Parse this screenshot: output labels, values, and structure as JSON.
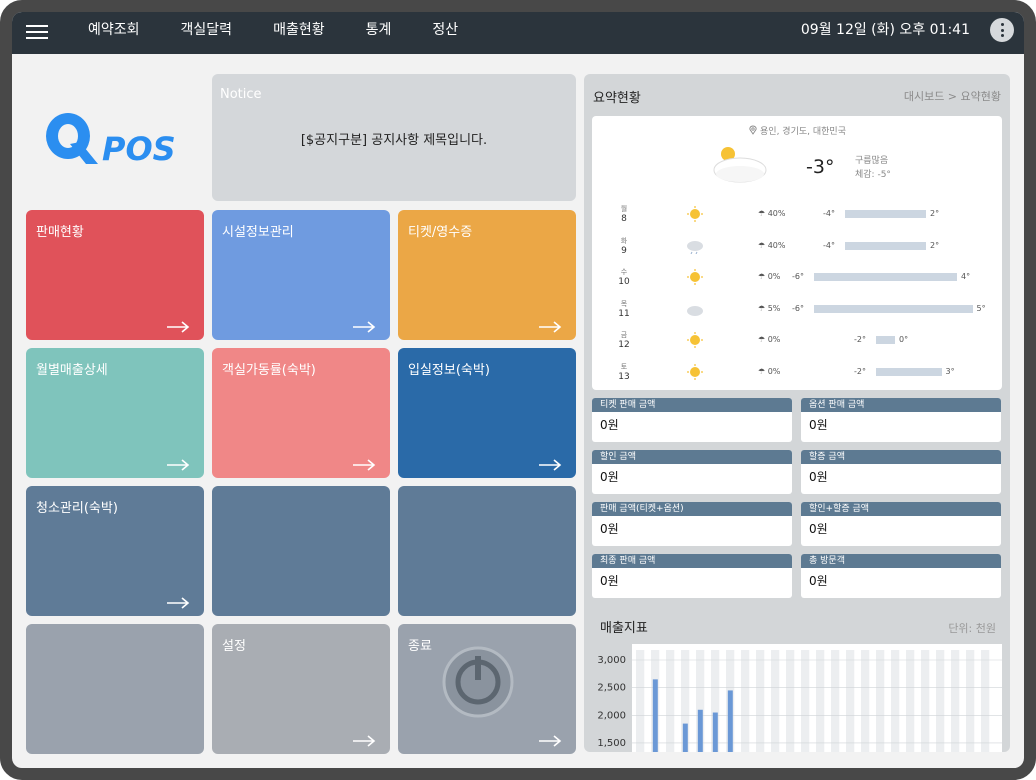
{
  "topbar": {
    "nav": [
      "예약조회",
      "객실달력",
      "매출현황",
      "통계",
      "정산"
    ],
    "datetime": "09월 12일 (화)  오후 01:41"
  },
  "notice": {
    "title": "Notice",
    "text": "[$공지구분] 공지사항 제목입니다."
  },
  "tiles": [
    {
      "label": "판매현황",
      "color": "#e0525a"
    },
    {
      "label": "시설정보관리",
      "color": "#6f9be0"
    },
    {
      "label": "티켓/영수증",
      "color": "#eba746"
    },
    {
      "label": "월별매출상세",
      "color": "#7fc4bc"
    },
    {
      "label": "객실가동률(숙박)",
      "color": "#f08787"
    },
    {
      "label": "입실정보(숙박)",
      "color": "#2a6aa8"
    },
    {
      "label": "청소관리(숙박)",
      "color": "#5f7b97"
    },
    {
      "label": "",
      "color": "#5f7b97"
    },
    {
      "label": "",
      "color": "#5f7b97"
    },
    {
      "label": "",
      "color": "#9aa2ad"
    },
    {
      "label": "설정",
      "color": "#a9adb3"
    },
    {
      "label": "종료",
      "color": "#9aa2ad"
    }
  ],
  "summary": {
    "title": "요약현황",
    "breadcrumb": "대시보드 > 요약현황"
  },
  "weather": {
    "location": "용인, 경기도, 대한민국",
    "temp": "-3°",
    "condition": "구름많음",
    "feels": "체감: -5°",
    "days": [
      {
        "wd": "월",
        "d": "8",
        "icon": "sun-icon",
        "pop": "40%",
        "lo": "-4°",
        "hi": "2°"
      },
      {
        "wd": "화",
        "d": "9",
        "icon": "rain-cloud-icon",
        "pop": "40%",
        "lo": "-4°",
        "hi": "2°"
      },
      {
        "wd": "수",
        "d": "10",
        "icon": "sun-icon",
        "pop": "0%",
        "lo": "-6°",
        "hi": "4°"
      },
      {
        "wd": "목",
        "d": "11",
        "icon": "cloud-icon",
        "pop": "5%",
        "lo": "-6°",
        "hi": "5°"
      },
      {
        "wd": "금",
        "d": "12",
        "icon": "sun-icon",
        "pop": "0%",
        "lo": "-2°",
        "hi": "0°"
      },
      {
        "wd": "토",
        "d": "13",
        "icon": "sun-icon",
        "pop": "0%",
        "lo": "-2°",
        "hi": "3°"
      }
    ]
  },
  "cards": [
    {
      "label": "티켓 판매 금액",
      "value": "0원"
    },
    {
      "label": "옵션 판매 금액",
      "value": "0원"
    },
    {
      "label": "할인 금액",
      "value": "0원"
    },
    {
      "label": "할증 금액",
      "value": "0원"
    },
    {
      "label": "판매 금액(티켓+옵션)",
      "value": "0원"
    },
    {
      "label": "할인+할증 금액",
      "value": "0원"
    },
    {
      "label": "최종 판매 금액",
      "value": "0원"
    },
    {
      "label": "총 방문객",
      "value": "0원"
    }
  ],
  "sales": {
    "title": "매출지표",
    "unit": "단위: 천원"
  },
  "chart_data": {
    "type": "bar",
    "y_ticks": [
      "3,000",
      "2,500",
      "2,000",
      "1,500"
    ],
    "ylim": [
      1300,
      3000
    ],
    "values": [
      2650,
      1850,
      2100,
      2050,
      2450
    ],
    "series_color": "#6a98d6"
  }
}
